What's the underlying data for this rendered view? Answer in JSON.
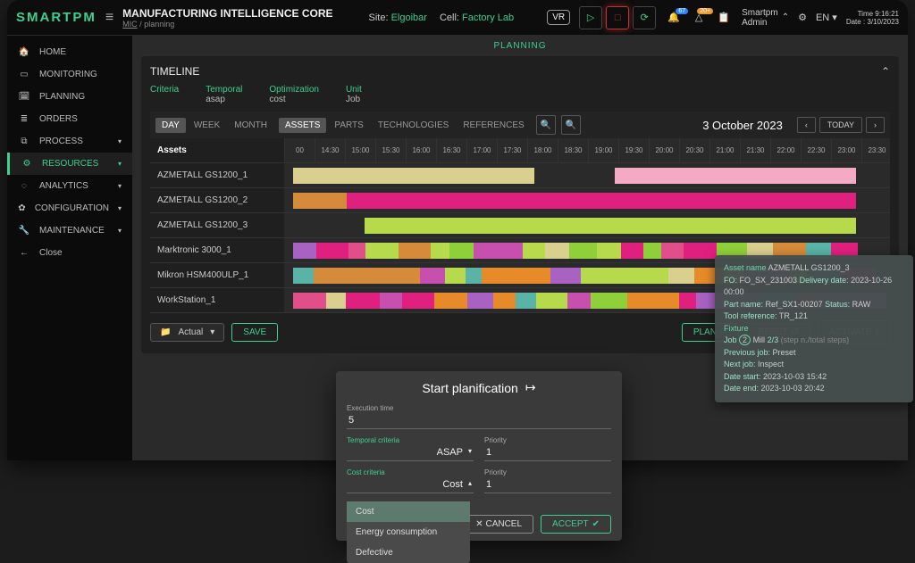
{
  "logo": "SMARTPM",
  "header": {
    "title": "MANUFACTURING INTELLIGENCE CORE",
    "path_root": "MIC",
    "path_leaf": "planning",
    "site_label": "Site:",
    "site_value": "Elgoibar",
    "cell_label": "Cell:",
    "cell_value": "Factory Lab",
    "vr": "VR",
    "notif1": "67",
    "notif2": "20+",
    "user_line1": "Smartpm",
    "user_line2": "Admin",
    "lang": "EN",
    "time_label": "Time",
    "time_value": "9:16:21",
    "date_label": "Date",
    "date_value": "3/10/2023"
  },
  "sidebar": [
    {
      "icon": "🏠",
      "label": "HOME"
    },
    {
      "icon": "▭",
      "label": "MONITORING"
    },
    {
      "icon": "🗓",
      "label": "PLANNING"
    },
    {
      "icon": "≣",
      "label": "ORDERS"
    },
    {
      "icon": "⧉",
      "label": "PROCESS",
      "caret": true
    },
    {
      "icon": "⚙",
      "label": "RESOURCES",
      "caret": true,
      "active": true
    },
    {
      "icon": "◌",
      "label": "ANALYTICS",
      "caret": true
    },
    {
      "icon": "✿",
      "label": "CONFIGURATION",
      "caret": true
    },
    {
      "icon": "🔧",
      "label": "MAINTENANCE",
      "caret": true
    },
    {
      "icon": "←",
      "label": "Close"
    }
  ],
  "subheader": "PLANNING",
  "panel_title": "TIMELINE",
  "criteria": {
    "c0": "Criteria",
    "c1k": "Temporal",
    "c1v": "asap",
    "c2k": "Optimization",
    "c2v": "cost",
    "c3k": "Unit",
    "c3v": "Job"
  },
  "view_tabs": {
    "day": "DAY",
    "week": "WEEK",
    "month": "MONTH"
  },
  "group_tabs": {
    "assets": "ASSETS",
    "parts": "PARTS",
    "tech": "TECHNOLOGIES",
    "refs": "REFERENCES"
  },
  "gantt": {
    "date": "3 October 2023",
    "today": "TODAY",
    "left_header": "Assets",
    "rows": [
      "AZMETALL GS1200_1",
      "AZMETALL GS1200_2",
      "AZMETALL GS1200_3",
      "Marktronic 3000_1",
      "Mikron HSM400ULP_1",
      "WorkStation_1"
    ],
    "times": [
      "00",
      "14:30",
      "15:00",
      "15:30",
      "16:00",
      "16:30",
      "17:00",
      "17:30",
      "18:00",
      "18:30",
      "19:00",
      "19:30",
      "20:00",
      "20:30",
      "21:00",
      "21:30",
      "22:00",
      "22:30",
      "23:00",
      "23:30"
    ]
  },
  "footer": {
    "actual": "Actual",
    "save": "SAVE",
    "plan": "PLAN",
    "reset": "RESET",
    "activate": "ACTIVATE"
  },
  "tooltip": {
    "asset_k": "Asset name",
    "asset_v": "AZMETALL GS1200_3",
    "fo_k": "FO:",
    "fo_v": "FO_SX_231003",
    "dd_k": "Delivery date:",
    "dd_v": "2023-10-26 00:00",
    "pn_k": "Part name:",
    "pn_v": "Ref_SX1-00207",
    "st_k": "Status:",
    "st_v": "RAW",
    "tr_k": "Tool reference:",
    "tr_v": "TR_121",
    "fx_k": "Fixture",
    "job_k": "Job",
    "job_n": "2",
    "job_name": "Mill",
    "job_step": "2/3",
    "job_note": "(step n./total steps)",
    "pj_k": "Previous job:",
    "pj_v": "Preset",
    "nj_k": "Next job:",
    "nj_v": "Inspect",
    "ds_k": "Date start:",
    "ds_v": "2023-10-03 15:42",
    "de_k": "Date end:",
    "de_v": "2023-10-03 20:42"
  },
  "modal": {
    "title": "Start planification",
    "exec_k": "Execution time",
    "exec_v": "5",
    "tc_k": "Temporal criteria",
    "tc_v": "ASAP",
    "pr_k": "Priority",
    "pr_v": "1",
    "cc_k": "Cost criteria",
    "cc_v": "Cost",
    "pr2_v": "1",
    "cancel": "CANCEL",
    "accept": "ACCEPT",
    "dd": [
      "Cost",
      "Energy consumption",
      "Defective"
    ]
  }
}
